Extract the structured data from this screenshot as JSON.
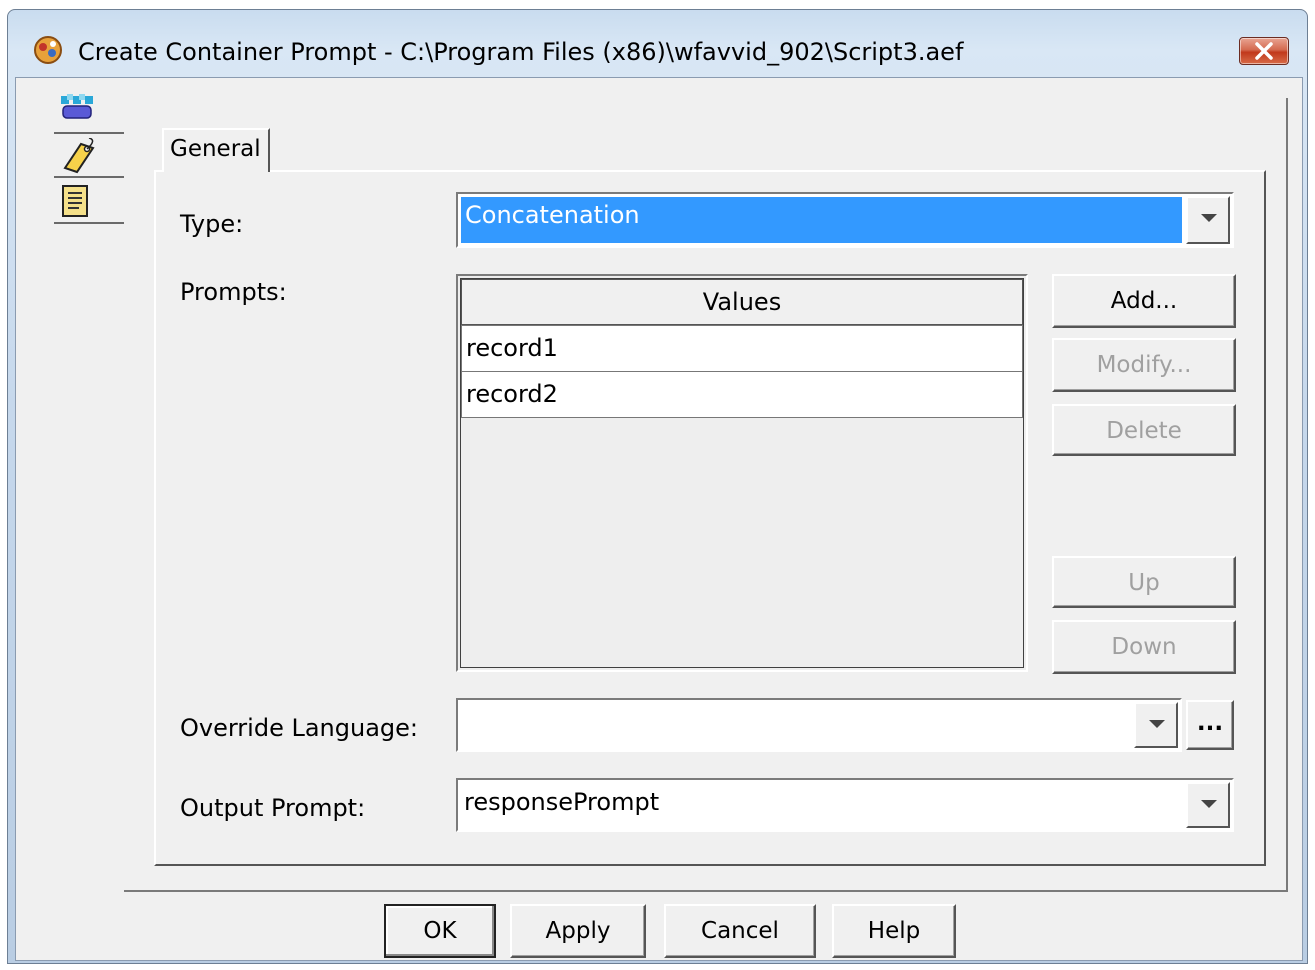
{
  "window": {
    "title": "Create Container Prompt - C:\\Program Files (x86)\\wfavvid_902\\Script3.aef"
  },
  "rail": {
    "items": [
      "general-icon",
      "tag-icon",
      "document-icon"
    ]
  },
  "tabs": [
    {
      "label": "General"
    }
  ],
  "form": {
    "type_label": "Type:",
    "type_value": "Concatenation",
    "prompts_label": "Prompts:",
    "prompts_table": {
      "header": "Values",
      "rows": [
        "record1",
        "record2"
      ]
    },
    "override_label": "Override Language:",
    "override_value": "",
    "output_label": "Output Prompt:",
    "output_value": "responsePrompt"
  },
  "side_buttons": {
    "add": "Add...",
    "modify": "Modify...",
    "delete": "Delete",
    "up": "Up",
    "down": "Down"
  },
  "ellipsis_button": "...",
  "footer": {
    "ok": "OK",
    "apply": "Apply",
    "cancel": "Cancel",
    "help": "Help"
  },
  "colors": {
    "selection": "#3399ff",
    "dialog_bg": "#f0f0f0",
    "close_button": "#c1391c"
  }
}
